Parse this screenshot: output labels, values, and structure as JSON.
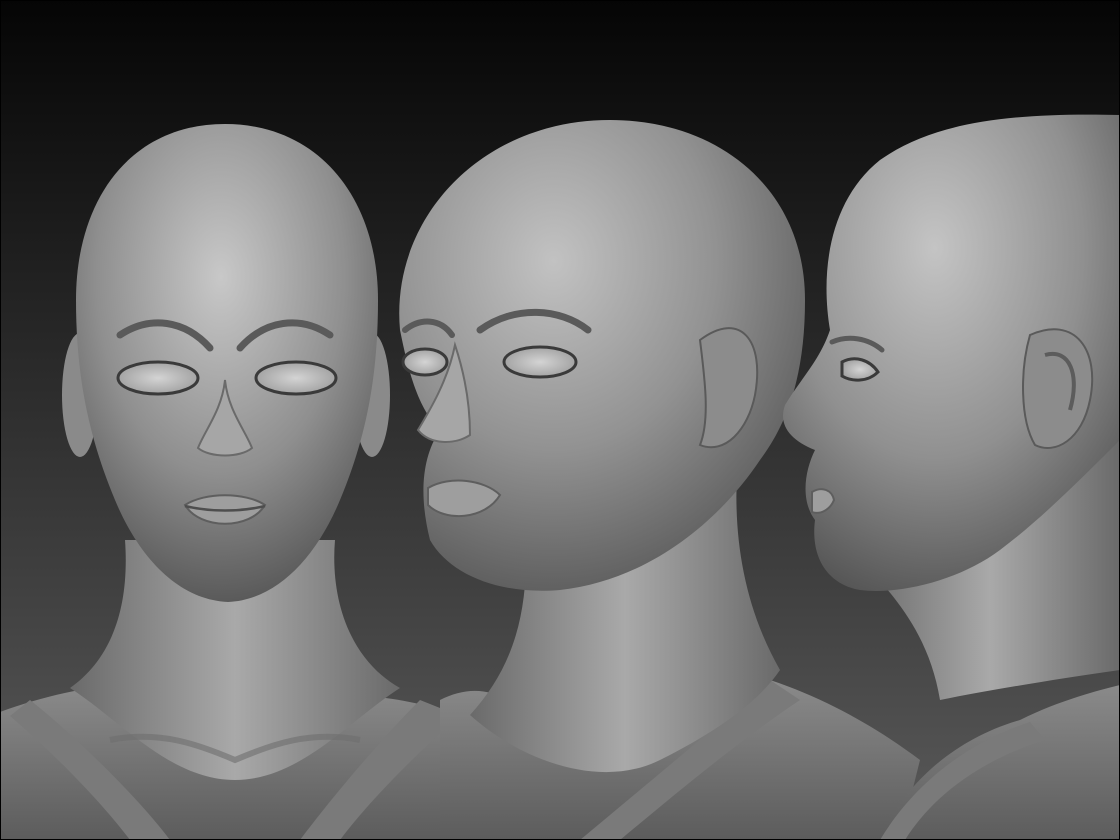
{
  "scene": {
    "kind": "3d-sculpt-render",
    "material": "matte-gray-clay",
    "views": [
      {
        "view": "front",
        "subject": "bald-female-head-bust"
      },
      {
        "view": "three-quarter",
        "subject": "bald-female-head-bust"
      },
      {
        "view": "side-profile",
        "subject": "bald-female-head-bust"
      }
    ]
  },
  "colors": {
    "background_top": "#050505",
    "background_bottom": "#5a5a5a",
    "clay_light": "#bdbdbd",
    "clay_mid": "#8f8f8f",
    "clay_dark": "#4a4a4a",
    "frame_border": "#000000"
  }
}
